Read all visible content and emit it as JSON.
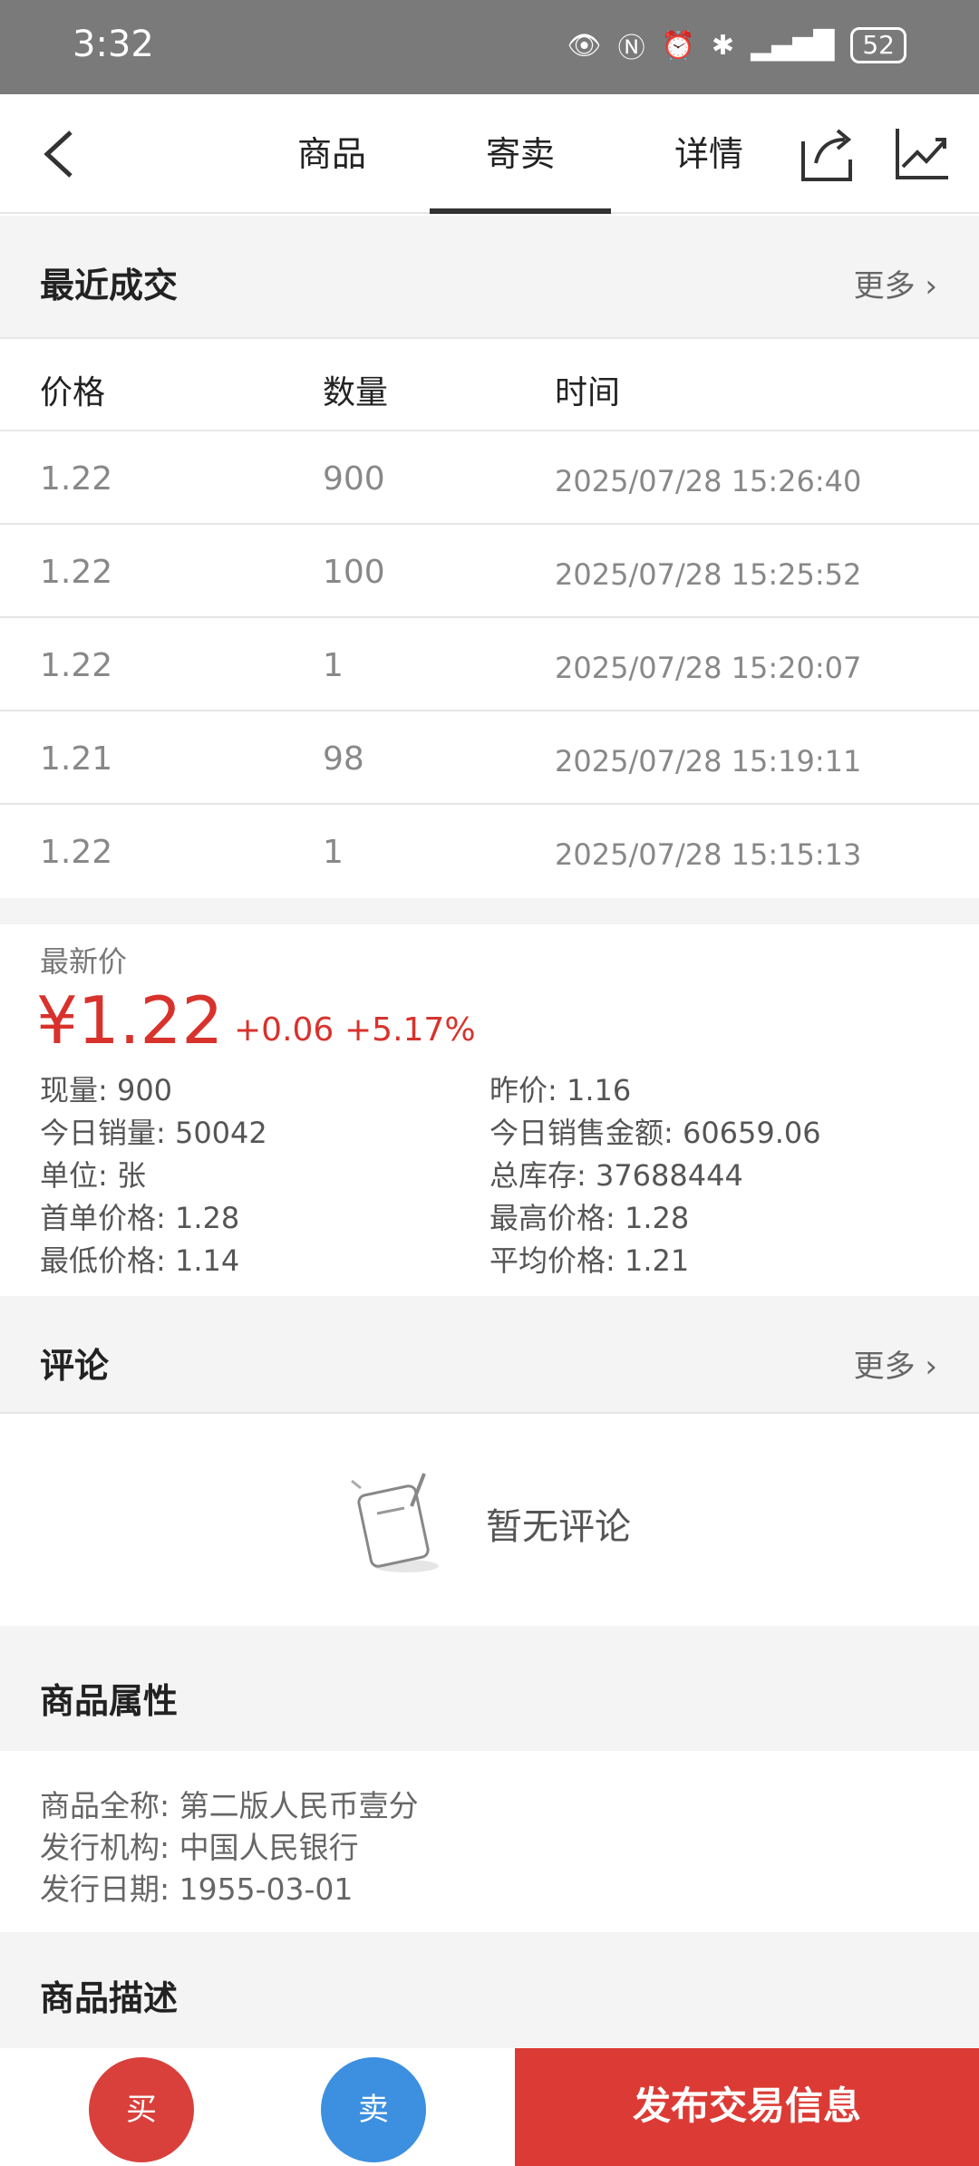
{
  "status_bar": {
    "time": "3:32",
    "battery": "52"
  },
  "nav": {
    "tabs": [
      {
        "label": "商品",
        "active": false
      },
      {
        "label": "寄卖",
        "active": true
      },
      {
        "label": "详情",
        "active": false
      }
    ]
  },
  "recent_trades": {
    "title": "最近成交",
    "more": "更多",
    "headers": {
      "price": "价格",
      "qty": "数量",
      "time": "时间"
    },
    "rows": [
      {
        "price": "1.22",
        "qty": "900",
        "time": "2025/07/28 15:26:40"
      },
      {
        "price": "1.22",
        "qty": "100",
        "time": "2025/07/28 15:25:52"
      },
      {
        "price": "1.22",
        "qty": "1",
        "time": "2025/07/28 15:20:07"
      },
      {
        "price": "1.21",
        "qty": "98",
        "time": "2025/07/28 15:19:11"
      },
      {
        "price": "1.22",
        "qty": "1",
        "time": "2025/07/28 15:15:13"
      }
    ]
  },
  "latest": {
    "label": "最新价",
    "price": "¥1.22",
    "change": "+0.06",
    "change_pct": "+5.17%",
    "left": [
      "现量: 900",
      "今日销量: 50042",
      "单位: 张",
      "首单价格:  1.28",
      "最低价格:  1.14"
    ],
    "right": [
      "昨价: 1.16",
      "今日销售金额: 60659.06",
      "总库存: 37688444",
      "最高价格:  1.28",
      "平均价格:  1.21"
    ]
  },
  "comments": {
    "title": "评论",
    "more": "更多",
    "empty_text": "暂无评论"
  },
  "attributes": {
    "title": "商品属性",
    "items": [
      "商品全称: 第二版人民币壹分",
      "发行机构: 中国人民银行",
      "发行日期: 1955-03-01"
    ]
  },
  "description": {
    "title": "商品描述"
  },
  "bottom": {
    "buy": "买",
    "sell": "卖",
    "publish": "发布交易信息"
  },
  "colors": {
    "accent_red": "#d8322c",
    "sell_blue": "#3d8fe0"
  },
  "icons": [
    "back-arrow-icon",
    "share-icon",
    "trend-chart-icon",
    "chevron-right-icon",
    "empty-comment-icon"
  ]
}
